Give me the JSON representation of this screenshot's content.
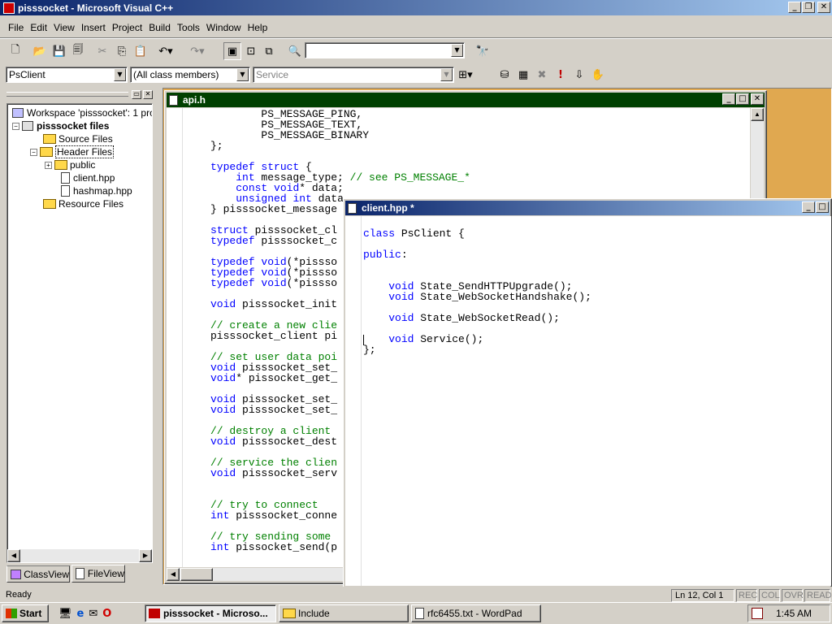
{
  "app": {
    "title": "pisssocket - Microsoft Visual C++"
  },
  "menu": [
    "File",
    "Edit",
    "View",
    "Insert",
    "Project",
    "Build",
    "Tools",
    "Window",
    "Help"
  ],
  "wizardbar": {
    "class_value": "PsClient",
    "filter_value": "(All class members)",
    "member_value": "Service"
  },
  "workspace": {
    "root": "Workspace 'pisssocket': 1 proje",
    "project": "pisssocket files",
    "items": [
      "Source Files",
      "Header Files",
      "public",
      "client.hpp",
      "hashmap.hpp",
      "Resource Files"
    ],
    "tabs": [
      "ClassView",
      "FileView"
    ]
  },
  "api_window": {
    "title": "api.h",
    "lines": [
      "        PS_MESSAGE_PING,",
      "        PS_MESSAGE_TEXT,",
      "        PS_MESSAGE_BINARY",
      "};",
      "",
      "typedef struct {",
      "    int message_type; // see PS_MESSAGE_*",
      "    const void* data;",
      "    unsigned int data",
      "} pisssocket_message",
      "",
      "struct pisssocket_cl",
      "typedef pisssocket_c",
      "",
      "typedef void(*pissso",
      "typedef void(*pissso",
      "typedef void(*pissso",
      "",
      "void pisssocket_init",
      "",
      "// create a new clie",
      "pisssocket_client pi",
      "",
      "// set user data poi",
      "void pisssocket_set_",
      "void* pissocket_get_",
      "",
      "void pisssocket_set_",
      "void pisssocket_set_",
      "",
      "// destroy a client",
      "void pisssocket_dest",
      "",
      "// service the clien",
      "void pisssocket_serv",
      "",
      "",
      "// try to connect",
      "int pisssocket_conne",
      "",
      "// try sending some",
      "int pissocket_send(p"
    ]
  },
  "client_window": {
    "title": "client.hpp *",
    "lines": [
      "",
      "class PsClient {",
      "",
      "public:",
      "",
      "",
      "    void State_SendHTTPUpgrade();",
      "    void State_WebSocketHandshake();",
      "",
      "    void State_WebSocketRead();",
      "",
      "    void Service();",
      "};"
    ]
  },
  "statusbar": {
    "ready": "Ready",
    "position": "Ln 12, Col 1",
    "indicators": [
      "REC",
      "COL",
      "OVR",
      "READ"
    ]
  },
  "taskbar": {
    "start": "Start",
    "tasks": [
      "pisssocket - Microso...",
      "Include",
      "rfc6455.txt - WordPad"
    ],
    "clock": "1:45 AM"
  },
  "colors": {
    "active_title": "#0a246a",
    "active_title_end": "#a6caf0",
    "api_title": "#004000",
    "keyword": "#0000ff",
    "comment": "#008000",
    "mdi_background": "#e0a850"
  }
}
